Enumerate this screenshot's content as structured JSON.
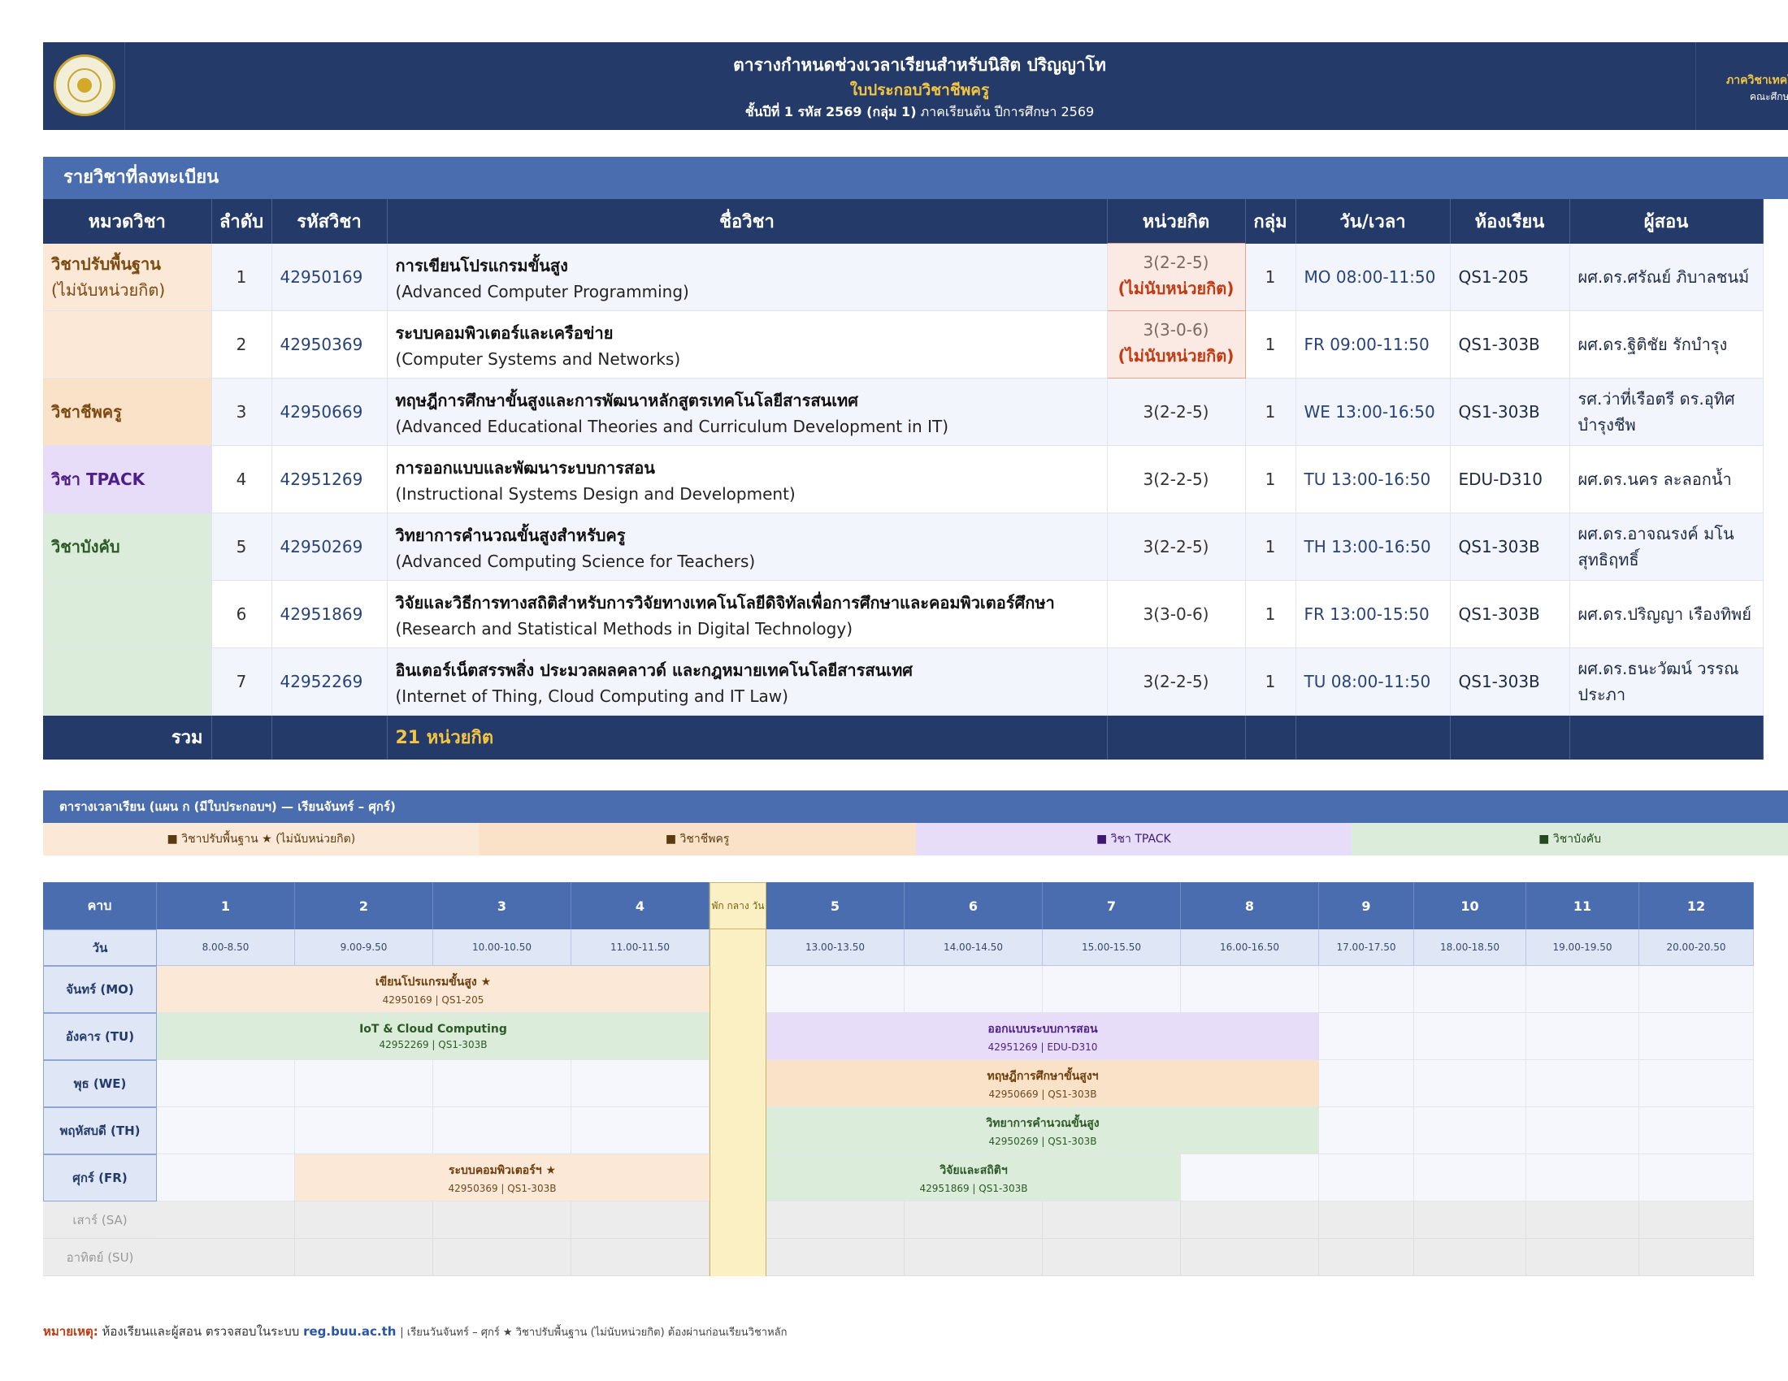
{
  "header": {
    "title": "ตารางกำหนดช่วงเวลาเรียนสำหรับนิสิต  ปริญญาโท",
    "subtitle": "ใบประกอบวิชาชีพครู",
    "info_bold": "ชั้นปีที่ 1  รหัส 2569  (กลุ่ม 1)",
    "info_rest": "ภาคเรียนต้น ปีการศึกษา 2569",
    "dept": "ภาควิชาเทคโนโลยีทางการศึกษา",
    "faculty": "คณะศึกษาศาสตร์"
  },
  "courses_section": {
    "title": "รายวิชาที่ลงทะเบียน",
    "columns": [
      "หมวดวิชา",
      "ลำดับ",
      "รหัสวิชา",
      "ชื่อวิชา",
      "หน่วยกิต",
      "กลุ่ม",
      "วัน/เวลา",
      "ห้องเรียน",
      "ผู้สอน"
    ],
    "rows": [
      {
        "cat": "วิชาปรับพื้นฐาน",
        "cat2": "(ไม่นับหน่วยกิต)",
        "cat_type": "found",
        "no": "1",
        "code": "42950169",
        "name_th": "การเขียนโปรแกรมขั้นสูง",
        "name_en": "(Advanced Computer Programming)",
        "credit": "3(2-2-5)",
        "credit_note": "(ไม่นับหน่วยกิต)",
        "group": "1",
        "time": "MO 08:00-11:50",
        "room": "QS1-205",
        "teacher": "ผศ.ดร.ศรัณย์ ภิบาลชนม์"
      },
      {
        "cat": "",
        "cat2": "",
        "cat_type": "found-empty",
        "no": "2",
        "code": "42950369",
        "name_th": "ระบบคอมพิวเตอร์และเครือข่าย",
        "name_en": "(Computer Systems and Networks)",
        "credit": "3(3-0-6)",
        "credit_note": "(ไม่นับหน่วยกิต)",
        "group": "1",
        "time": "FR 09:00-11:50",
        "room": "QS1-303B",
        "teacher": "ผศ.ดร.ฐิติชัย รักบำรุง"
      },
      {
        "cat": "วิชาชีพครู",
        "cat2": "",
        "cat_type": "prof",
        "no": "3",
        "code": "42950669",
        "name_th": "ทฤษฎีการศึกษาขั้นสูงและการพัฒนาหลักสูตรเทคโนโลยีสารสนเทศ",
        "name_en": "(Advanced Educational Theories and Curriculum Development in IT)",
        "credit": "3(2-2-5)",
        "credit_note": "",
        "group": "1",
        "time": "WE 13:00-16:50",
        "room": "QS1-303B",
        "teacher": "รศ.ว่าที่เรือตรี ดร.อุทิศ บำรุงชีพ"
      },
      {
        "cat": "วิชา TPACK",
        "cat2": "",
        "cat_type": "tpack",
        "no": "4",
        "code": "42951269",
        "name_th": "การออกแบบและพัฒนาระบบการสอน",
        "name_en": "(Instructional Systems Design and Development)",
        "credit": "3(2-2-5)",
        "credit_note": "",
        "group": "1",
        "time": "TU 13:00-16:50",
        "room": "EDU-D310",
        "teacher": "ผศ.ดร.นคร ละลอกน้ำ"
      },
      {
        "cat": "วิชาบังคับ",
        "cat2": "",
        "cat_type": "core",
        "no": "5",
        "code": "42950269",
        "name_th": "วิทยาการคำนวณขั้นสูงสำหรับครู",
        "name_en": "(Advanced Computing Science for Teachers)",
        "credit": "3(2-2-5)",
        "credit_note": "",
        "group": "1",
        "time": "TH 13:00-16:50",
        "room": "QS1-303B",
        "teacher": "ผศ.ดร.อาจณรงค์ มโนสุทธิฤทธิ์"
      },
      {
        "cat": "",
        "cat2": "",
        "cat_type": "core-empty",
        "no": "6",
        "code": "42951869",
        "name_th": "วิจัยและวิธีการทางสถิติสำหรับการวิจัยทางเทคโนโลยีดิจิทัลเพื่อการศึกษาและคอมพิวเตอร์ศึกษา",
        "name_en": "(Research and Statistical Methods in Digital Technology)",
        "credit": "3(3-0-6)",
        "credit_note": "",
        "group": "1",
        "time": "FR 13:00-15:50",
        "room": "QS1-303B",
        "teacher": "ผศ.ดร.ปริญญา เรืองทิพย์"
      },
      {
        "cat": "",
        "cat2": "",
        "cat_type": "core-empty",
        "no": "7",
        "code": "42952269",
        "name_th": "อินเตอร์เน็ตสรรพสิ่ง ประมวลผลคลาวด์ และกฎหมายเทคโนโลยีสารสนเทศ",
        "name_en": "(Internet of Thing, Cloud Computing and IT Law)",
        "credit": "3(2-2-5)",
        "credit_note": "",
        "group": "1",
        "time": "TU 08:00-11:50",
        "room": "QS1-303B",
        "teacher": "ผศ.ดร.ธนะวัฒน์ วรรณประภา"
      }
    ],
    "total_label": "รวม",
    "total_value": "21  หน่วยกิต"
  },
  "timetable": {
    "title": "ตารางเวลาเรียน  (แผน ก (มีใบประกอบฯ) — เรียนจันทร์ – ศุกร์)",
    "legend": [
      {
        "label": "■  วิชาปรับพื้นฐาน ★ (ไม่นับหน่วยกิต)",
        "type": "found"
      },
      {
        "label": "■  วิชาชีพครู",
        "type": "prof"
      },
      {
        "label": "■  วิชา TPACK",
        "type": "tpack"
      },
      {
        "label": "■  วิชาบังคับ",
        "type": "core"
      }
    ],
    "period_label": "คาบ",
    "day_label": "วัน",
    "lunch_label": "พัก กลาง วัน",
    "periods": [
      "1",
      "2",
      "3",
      "4",
      "5",
      "6",
      "7",
      "8",
      "9",
      "10",
      "11",
      "12"
    ],
    "times": [
      "8.00-8.50",
      "9.00-9.50",
      "10.00-10.50",
      "11.00-11.50",
      "13.00-13.50",
      "14.00-14.50",
      "15.00-15.50",
      "16.00-16.50",
      "17.00-17.50",
      "18.00-18.50",
      "19.00-19.50",
      "20.00-20.50"
    ],
    "days": [
      {
        "label": "จันทร์ (MO)",
        "off": false
      },
      {
        "label": "อังคาร (TU)",
        "off": false
      },
      {
        "label": "พุธ (WE)",
        "off": false
      },
      {
        "label": "พฤหัสบดี (TH)",
        "off": false
      },
      {
        "label": "ศุกร์ (FR)",
        "off": false
      },
      {
        "label": "เสาร์ (SA)",
        "off": true
      },
      {
        "label": "อาทิตย์ (SU)",
        "off": true
      }
    ],
    "blocks": [
      {
        "day": 0,
        "start": 0,
        "span": 4,
        "type": "found",
        "title": "เขียนโปรแกรมขั้นสูง ★",
        "sub": "42950169 | QS1-205"
      },
      {
        "day": 1,
        "start": 0,
        "span": 4,
        "type": "core",
        "title": "IoT & Cloud Computing",
        "sub": "42952269 | QS1-303B"
      },
      {
        "day": 1,
        "start": 4,
        "span": 4,
        "type": "tpack",
        "title": "ออกแบบระบบการสอน",
        "sub": "42951269 | EDU-D310"
      },
      {
        "day": 2,
        "start": 4,
        "span": 4,
        "type": "prof",
        "title": "ทฤษฎีการศึกษาขั้นสูงฯ",
        "sub": "42950669 | QS1-303B"
      },
      {
        "day": 3,
        "start": 4,
        "span": 4,
        "type": "core",
        "title": "วิทยาการคำนวณขั้นสูง",
        "sub": "42950269 | QS1-303B"
      },
      {
        "day": 4,
        "start": 1,
        "span": 3,
        "type": "found",
        "title": "ระบบคอมพิวเตอร์ฯ ★",
        "sub": "42950369 | QS1-303B"
      },
      {
        "day": 4,
        "start": 4,
        "span": 3,
        "type": "core",
        "title": "วิจัยและสถิติฯ",
        "sub": "42951869 | QS1-303B"
      }
    ]
  },
  "note": {
    "label": "หมายเหตุ:",
    "text": "ห้องเรียนและผู้สอน ตรวจสอบในระบบ",
    "link": "reg.buu.ac.th",
    "rest": "  |  เรียนวันจันทร์ – ศุกร์  ★ วิชาปรับพื้นฐาน (ไม่นับหน่วยกิต) ต้องผ่านก่อนเรียนวิชาหลัก"
  }
}
